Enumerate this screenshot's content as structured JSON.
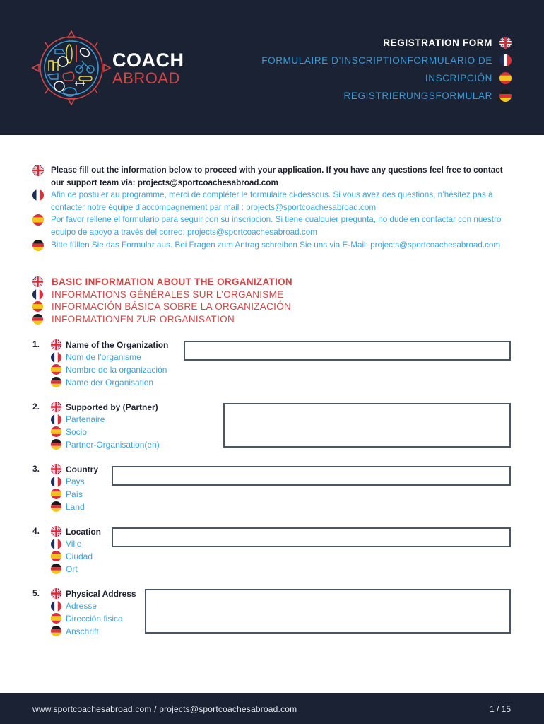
{
  "header": {
    "logo": {
      "line1": "COACH",
      "line2": "ABROAD"
    },
    "titles": [
      {
        "lang": "en",
        "text": "REGISTRATION FORM",
        "flag": "uk-flag-icon"
      },
      {
        "lang": "fr",
        "text": "FORMULAIRE D’INSCRIPTIONFORMULARIO DE",
        "flag": "france-flag-icon"
      },
      {
        "lang": "es",
        "text": "INSCRIPCIÓN",
        "flag": "spain-flag-icon"
      },
      {
        "lang": "de",
        "text": "REGISTRIERUNGSFORMULAR",
        "flag": "germany-flag-icon"
      }
    ]
  },
  "intro": [
    {
      "lang": "en",
      "text": "Please fill out the information below to proceed with your application. If you have any questions feel free to contact our support team via: projects@sportcoachesabroad.com"
    },
    {
      "lang": "fr",
      "text": "Afin de postuler au programme, merci de compléter le formulaire ci-dessous. Si vous avez des questions, n’hésitez pas à contacter notre équipe d’accompagnement par mail : projects@sportcoachesabroad.com"
    },
    {
      "lang": "es",
      "text": "Por favor rellene el formulario para seguir con su inscripción. Si tiene cualquier pregunta, no dude en contactar con nuestro equipo de apoyo a través del correo: projects@sportcoachesabroad.com"
    },
    {
      "lang": "de",
      "text": "Bitte füllen Sie das Formular aus. Bei Fragen zum Antrag schreiben Sie uns via E-Mail: projects@sportcoachesabroad.com"
    }
  ],
  "section": {
    "titles": [
      {
        "lang": "en",
        "text": "BASIC INFORMATION ABOUT THE ORGANIZATION"
      },
      {
        "lang": "fr",
        "text": "INFORMATIONS GÉNÉRALES SUR L’ORGANISME"
      },
      {
        "lang": "es",
        "text": "INFORMACIÓN BÁSICA SOBRE LA ORGANIZACIÓN"
      },
      {
        "lang": "de",
        "text": "INFORMATIONEN ZUR ORGANISATION"
      }
    ]
  },
  "fields": [
    {
      "number": "1.",
      "labels": {
        "en": "Name  of the Organization",
        "fr": "Nom de l’organisme",
        "es": "Nombre de la organización",
        "de": "Name der Organisation"
      },
      "value": ""
    },
    {
      "number": "2.",
      "labels": {
        "en": "Supported by (Partner)",
        "fr": "Partenaire",
        "es": "Socio",
        "de": "Partner-Organisation(en)"
      },
      "value": ""
    },
    {
      "number": "3.",
      "labels": {
        "en": "Country",
        "fr": "Pays",
        "es": "País",
        "de": "Land"
      },
      "value": ""
    },
    {
      "number": "4.",
      "labels": {
        "en": "Location",
        "fr": "Ville",
        "es": "Ciudad",
        "de": "Ort"
      },
      "value": ""
    },
    {
      "number": "5.",
      "labels": {
        "en": "Physical Address",
        "fr": "Adresse",
        "es": "Dirección fisica",
        "de": "Anschrift"
      },
      "value": ""
    }
  ],
  "footer": {
    "links": "www.sportcoachesabroad.com  /  projects@sportcoachesabroad.com",
    "page": "1 / 15"
  },
  "colors": {
    "header_bg": "#1a2234",
    "accent_red": "#d04545",
    "accent_blue": "#3aa2e0",
    "text_dark": "#1d2230"
  }
}
